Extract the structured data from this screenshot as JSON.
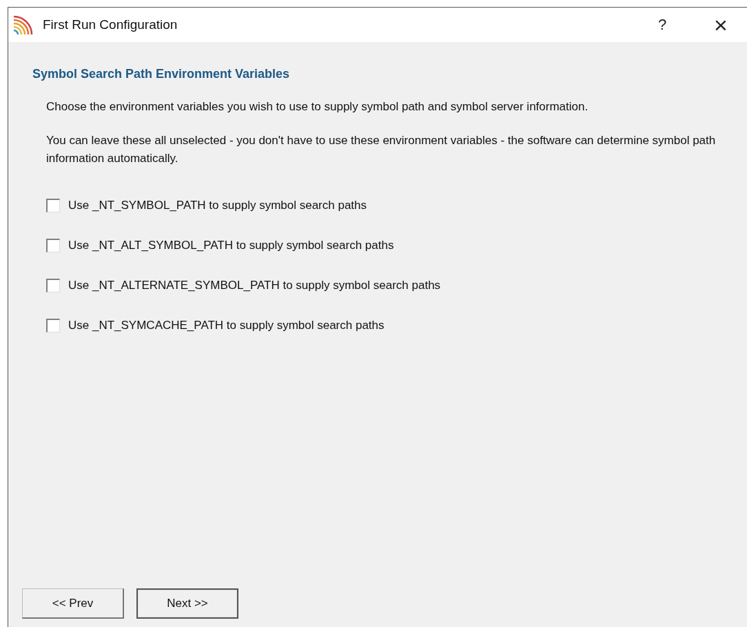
{
  "window": {
    "title": "First Run Configuration",
    "help_button": "?",
    "close_button": "×"
  },
  "heading": "Symbol Search Path Environment Variables",
  "paragraphs": [
    "Choose the environment variables you wish to use to supply symbol path and symbol server information.",
    "You can leave these all unselected - you don't have to use these environment variables - the software can determine symbol path information automatically."
  ],
  "options": [
    {
      "label": "Use _NT_SYMBOL_PATH to supply symbol search paths",
      "checked": false
    },
    {
      "label": "Use _NT_ALT_SYMBOL_PATH to supply symbol search paths",
      "checked": false
    },
    {
      "label": "Use _NT_ALTERNATE_SYMBOL_PATH to supply symbol search paths",
      "checked": false
    },
    {
      "label": "Use _NT_SYMCACHE_PATH to supply symbol search paths",
      "checked": false
    }
  ],
  "buttons": [
    {
      "label": "<< Prev",
      "default": false
    },
    {
      "label": "Next >>",
      "default": true
    }
  ]
}
